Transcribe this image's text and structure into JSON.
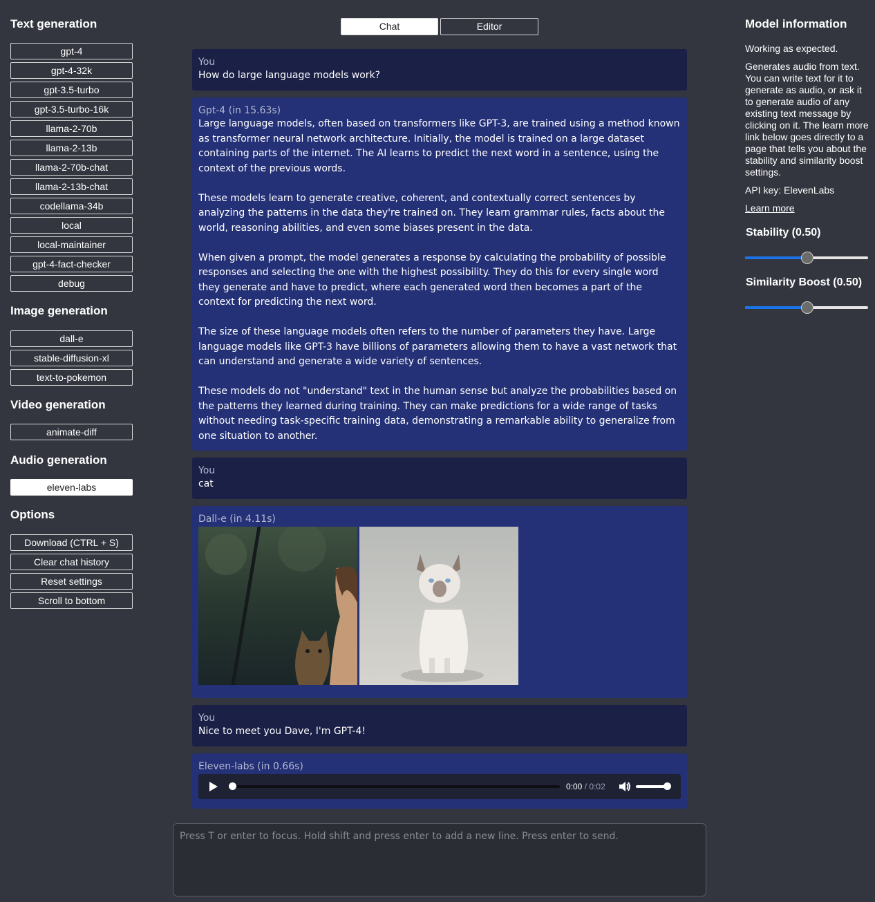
{
  "sidebar": {
    "text_generation": {
      "title": "Text generation",
      "models": [
        "gpt-4",
        "gpt-4-32k",
        "gpt-3.5-turbo",
        "gpt-3.5-turbo-16k",
        "llama-2-70b",
        "llama-2-13b",
        "llama-2-70b-chat",
        "llama-2-13b-chat",
        "codellama-34b",
        "local",
        "local-maintainer",
        "gpt-4-fact-checker",
        "debug"
      ]
    },
    "image_generation": {
      "title": "Image generation",
      "models": [
        "dall-e",
        "stable-diffusion-xl",
        "text-to-pokemon"
      ]
    },
    "video_generation": {
      "title": "Video generation",
      "models": [
        "animate-diff"
      ]
    },
    "audio_generation": {
      "title": "Audio generation",
      "models": [
        "eleven-labs"
      ],
      "selected": "eleven-labs"
    },
    "options": {
      "title": "Options",
      "buttons": [
        "Download (CTRL + S)",
        "Clear chat history",
        "Reset settings",
        "Scroll to bottom"
      ]
    }
  },
  "tabs": {
    "chat": "Chat",
    "editor": "Editor",
    "active": "Chat"
  },
  "messages": [
    {
      "author": "You",
      "text": "How do large language models work?"
    },
    {
      "author": "Gpt-4 (in 15.63s)",
      "paragraphs": [
        "Large language models, often based on transformers like GPT-3, are trained using a method known as transformer neural network architecture. Initially, the model is trained on a large dataset containing parts of the internet. The AI learns to predict the next word in a sentence, using the context of the previous words.",
        "These models learn to generate creative, coherent, and contextually correct sentences by analyzing the patterns in the data they're trained on. They learn grammar rules, facts about the world, reasoning abilities, and even some biases present in the data.",
        "When given a prompt, the model generates a response by calculating the probability of possible responses and selecting the one with the highest possibility. They do this for every single word they generate and have to predict, where each generated word then becomes a part of the context for predicting the next word.",
        "The size of these language models often refers to the number of parameters they have. Large language models like GPT-3 have billions of parameters allowing them to have a vast network that can understand and generate a wide variety of sentences.",
        "These models do not \"understand\" text in the human sense but analyze the probabilities based on the patterns they learned during training. They can make predictions for a wide range of tasks without needing task-specific training data, demonstrating a remarkable ability to generalize from one situation to another."
      ]
    },
    {
      "author": "You",
      "text": "cat"
    },
    {
      "author": "Dall-e (in 4.11s)"
    },
    {
      "author": "You",
      "text": "Nice to meet you Dave, I'm GPT-4!"
    },
    {
      "author": "Eleven-labs (in 0.66s)",
      "audio": {
        "current": "0:00",
        "separator": "/",
        "duration": "0:02",
        "progress": 0.0,
        "volume": 1.0
      }
    }
  ],
  "input": {
    "placeholder": "Press T or enter to focus. Hold shift and press enter to add a new line. Press enter to send."
  },
  "model_info": {
    "title": "Model information",
    "status": "Working as expected.",
    "description": "Generates audio from text. You can write text for it to generate as audio, or ask it to generate audio of any existing text message by clicking on it. The learn more link below goes directly to a page that tells you about the stability and similarity boost settings.",
    "api_key": "API key: ElevenLabs",
    "learn_more": "Learn more",
    "stability": {
      "label": "Stability (0.50)",
      "value": 0.5
    },
    "similarity": {
      "label": "Similarity Boost (0.50)",
      "value": 0.5
    }
  },
  "colors": {
    "background": "#33363f",
    "user_bubble": "#1b2047",
    "bot_bubble": "#243177",
    "slider_accent": "#1a73e8"
  }
}
